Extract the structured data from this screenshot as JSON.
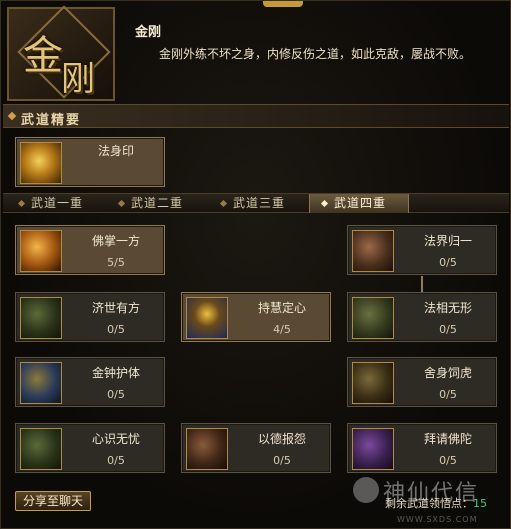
{
  "header": {
    "emblem_chars": [
      "金",
      "刚"
    ],
    "title": "金刚",
    "description": "金刚外练不坏之身，内修反伤之道，如此克敌，屡战不败。"
  },
  "section": {
    "title": "武道精要"
  },
  "core": {
    "name": "法身印"
  },
  "tabs": [
    {
      "label": "武道一重",
      "selected": false
    },
    {
      "label": "武道二重",
      "selected": false
    },
    {
      "label": "武道三重",
      "selected": false
    },
    {
      "label": "武道四重",
      "selected": true
    }
  ],
  "skills": {
    "fozhang": {
      "name": "佛掌一方",
      "level": "5/5",
      "icon": "golden-palm-icon",
      "color": "#d4891f"
    },
    "fajie": {
      "name": "法界归一",
      "level": "0/5",
      "icon": "dharma-wheel-icon",
      "color": "#8a4aa0"
    },
    "jishi": {
      "name": "济世有方",
      "level": "0/5",
      "icon": "swastika-icon",
      "color": "#2e5a2a"
    },
    "chihui": {
      "name": "持慧定心",
      "level": "4/5",
      "icon": "meditation-icon",
      "color": "#2f5ba0"
    },
    "faxiang": {
      "name": "法相无形",
      "level": "0/5",
      "icon": "dharma-form-icon",
      "color": "#4b5a30"
    },
    "jinzhong": {
      "name": "金钟护体",
      "level": "0/5",
      "icon": "golden-bell-icon",
      "color": "#2b5796"
    },
    "sheshen": {
      "name": "舍身饲虎",
      "level": "0/5",
      "icon": "tiger-sacrifice-icon",
      "color": "#6b5a2a"
    },
    "xinshi": {
      "name": "心识无忧",
      "level": "0/5",
      "icon": "mind-calm-icon",
      "color": "#2e5a2a"
    },
    "yide": {
      "name": "以德报怨",
      "level": "0/5",
      "icon": "virtue-return-icon",
      "color": "#6b4a2a"
    },
    "baiqing": {
      "name": "拜请佛陀",
      "level": "0/5",
      "icon": "buddha-prayer-icon",
      "color": "#6a3a8e"
    }
  },
  "footer": {
    "share_label": "分享至聊天",
    "points_label": "剩余武道领悟点：",
    "points_value": "15",
    "watermark_text": "神仙代信",
    "watermark_url": "WWW.SXDS.COM"
  }
}
